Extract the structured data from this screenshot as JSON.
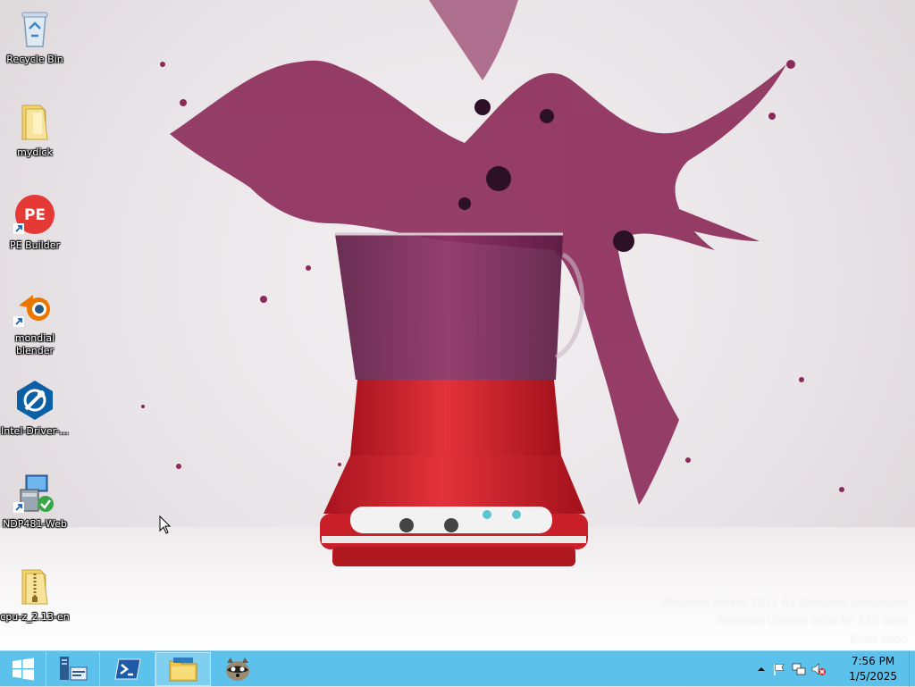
{
  "desktop": {
    "icons": [
      {
        "label": "Recycle Bin",
        "icon": "recycle-bin-icon"
      },
      {
        "label": "mydick",
        "icon": "folder-icon"
      },
      {
        "label": "PE Builder",
        "icon": "pe-builder-icon"
      },
      {
        "label": "mondial\nblender",
        "icon": "blender-icon"
      },
      {
        "label": "Intel-Driver-...",
        "icon": "intel-driver-icon"
      },
      {
        "label": "NDP481-Web",
        "icon": "installer-icon"
      },
      {
        "label": "cpu-z_2.13-en",
        "icon": "zip-folder-icon"
      }
    ],
    "watermark": {
      "line1": "Windows Server 2012 R2 Standard Evaluation",
      "line2": "Windows License valid for 180 days",
      "line3": "Build 9600"
    }
  },
  "taskbar": {
    "buttons": [
      {
        "name": "start",
        "icon": "windows-logo-icon"
      },
      {
        "name": "server-manager",
        "icon": "server-manager-icon"
      },
      {
        "name": "powershell",
        "icon": "powershell-icon"
      },
      {
        "name": "file-explorer",
        "icon": "file-explorer-icon"
      },
      {
        "name": "raccoon-app",
        "icon": "raccoon-icon"
      }
    ],
    "tray": {
      "time": "7:56 PM",
      "date": "1/5/2025",
      "icons": [
        "chevron-up-icon",
        "flag-icon",
        "network-icon",
        "volume-muted-icon"
      ]
    }
  },
  "colors": {
    "taskbar": "#5cc2ec",
    "blender_red": "#d62a36",
    "juice": "#8a2457"
  }
}
